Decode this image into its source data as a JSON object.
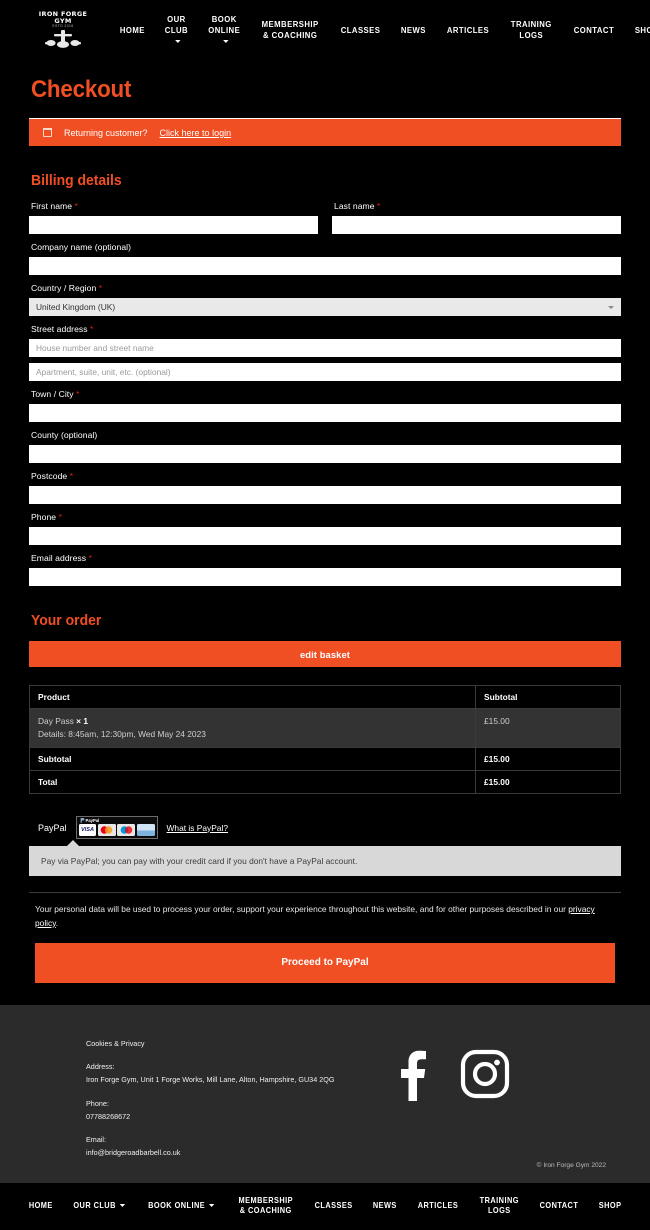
{
  "brand": {
    "logo_name": "IRON FORGE GYM",
    "logo_sub": "ESTD 2016",
    "accent": "#F04E23",
    "required_color": "#e2231a"
  },
  "header": {
    "nav": [
      {
        "label": "HOME",
        "caret": false
      },
      {
        "label": "OUR CLUB",
        "caret": true
      },
      {
        "label": "BOOK ONLINE",
        "caret": true
      },
      {
        "label": "MEMBERSHIP\n& COACHING",
        "caret": false
      },
      {
        "label": "CLASSES",
        "caret": false
      },
      {
        "label": "NEWS",
        "caret": false
      },
      {
        "label": "ARTICLES",
        "caret": false
      },
      {
        "label": "TRAINING\nLOGS",
        "caret": false
      },
      {
        "label": "CONTACT",
        "caret": false
      },
      {
        "label": "SHOP",
        "caret": false
      }
    ],
    "search_icon": "search-icon"
  },
  "page": {
    "title": "Checkout"
  },
  "login_notice": {
    "icon": "login-box-icon",
    "text": "Returning customer?",
    "link": "Click here to login"
  },
  "billing": {
    "heading": "Billing details",
    "first_name": {
      "label": "First name",
      "required": true,
      "value": ""
    },
    "last_name": {
      "label": "Last name",
      "required": true,
      "value": ""
    },
    "company": {
      "label": "Company name (optional)",
      "required": false,
      "value": ""
    },
    "country": {
      "label": "Country / Region",
      "required": true,
      "value": "United Kingdom (UK)"
    },
    "street": {
      "label": "Street address",
      "required": true,
      "value": "",
      "placeholder": "House number and street name"
    },
    "street2": {
      "value": "",
      "placeholder": "Apartment, suite, unit, etc. (optional)"
    },
    "town": {
      "label": "Town / City",
      "required": true,
      "value": ""
    },
    "county": {
      "label": "County (optional)",
      "required": false,
      "value": ""
    },
    "postcode": {
      "label": "Postcode",
      "required": true,
      "value": ""
    },
    "phone": {
      "label": "Phone",
      "required": true,
      "value": ""
    },
    "email": {
      "label": "Email address",
      "required": true,
      "value": ""
    }
  },
  "order": {
    "heading": "Your order",
    "edit_basket_label": "edit basket",
    "columns": [
      "Product",
      "Subtotal"
    ],
    "items": [
      {
        "name": "Day Pass",
        "quantity": "× 1",
        "details": "Details: 8:45am, 12:30pm, Wed May 24 2023",
        "subtotal": "£15.00"
      }
    ],
    "summary": [
      {
        "label": "Subtotal",
        "value": "£15.00"
      },
      {
        "label": "Total",
        "value": "£15.00"
      }
    ]
  },
  "payment": {
    "method_label": "PayPal",
    "cards": [
      "VISA",
      "MasterCard",
      "Maestro",
      "Bank"
    ],
    "paypal_badge": "PayPal",
    "what_is_link": "What is PayPal?",
    "description": "Pay via PayPal; you can pay with your credit card if you don't have a PayPal account.",
    "privacy_text_before": "Your personal data will be used to process your order, support your experience throughout this website, and for other purposes described in our ",
    "privacy_link": "privacy policy",
    "privacy_text_after": ".",
    "submit_label": "Proceed to PayPal"
  },
  "footer": {
    "cookies_link": "Cookies & Privacy",
    "address_label": "Address:",
    "address_value": "Iron Forge Gym, Unit 1 Forge Works, Mill Lane, Alton, Hampshire, GU34 2QG",
    "phone_label": "Phone:",
    "phone_value": "07788268672",
    "email_label": "Email:",
    "email_value": "info@bridgeroadbarbell.co.uk",
    "social": [
      "facebook-icon",
      "instagram-icon"
    ],
    "copyright": "© Iron Forge Gym 2022"
  }
}
